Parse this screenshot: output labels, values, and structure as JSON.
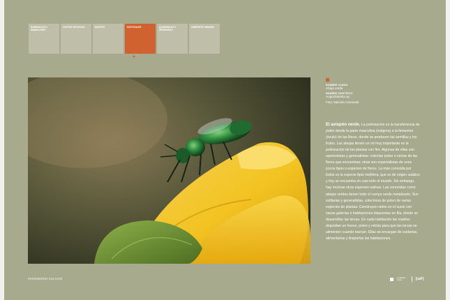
{
  "nav": {
    "tabs": [
      {
        "label": "Humedales y manglares",
        "active": false
      },
      {
        "label": "Costas rocosas",
        "active": false
      },
      {
        "label": "Montes",
        "active": false
      },
      {
        "label": "Pastizales",
        "active": true
      },
      {
        "label": "Quebradas y serranías",
        "active": false
      },
      {
        "label": "Ambiente urbano",
        "active": false
      }
    ]
  },
  "species": {
    "common_name_label": "Nombre común",
    "common_name": "Abeja verde",
    "scientific_name_label": "Nombre científico",
    "scientific_name": "Augochlorella sp.",
    "photo_credit": "Foto: Marcela Casciaotti"
  },
  "body": {
    "lead": "El avispón verde.",
    "text": "La polinización es la transferencia de polen desde la parte masculina (estigma) a la femenina (óvulo) de las flores, donde se producen las semillas y los frutos. Las abejas tienen un rol muy importante en la polinización de las plantas con flor. Algunas de ellas son oportunistas y generalistas: colectan polen o néctar de las flores que encuentran; otras son especialistas de unos pocos tipos o especies de flores. La más conocida por todos es la especie Apis mellifera, que es de origen asiático y hoy se encuentra en casi todo el mundo. Sin embargo, hay muchas otras especies nativas. Las conocidas como abejas verdes tienen todo el cuerpo verde metalizado. Son solitarias y generalistas, colectoras de polen de varias especies de plantas. Construyen nidos en el suelo con varias galerías o habitaciones dispuestas en fila, donde se desarrollan las larvas. En cada habitación las madres depositan un huevo, polen y néctar para que las larvas se alimenten cuando nazcan. Ellas se encargan de cuidarlas, alimentarlas y limpiarlas las habitaciones."
  },
  "footer": {
    "left": "Patrimonio salvaje",
    "logo_text": "Fundación Azara",
    "logo_mark": "[caF]"
  },
  "colors": {
    "panel": "#a8aa8e",
    "tab": "#bfbfa9",
    "accent": "#d0622f"
  }
}
